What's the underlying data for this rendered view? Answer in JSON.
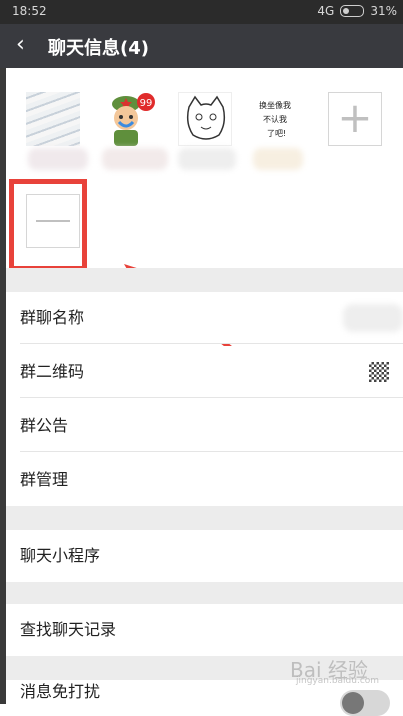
{
  "status_bar": {
    "time": "18:52",
    "network": "4G",
    "battery": "31%"
  },
  "header": {
    "back_icon": "chevron-left-icon",
    "title": "聊天信息(4)"
  },
  "members": {
    "avatars": [
      {
        "kind": "photo"
      },
      {
        "kind": "cartoon-soldier",
        "badge": "99"
      },
      {
        "kind": "cat-sketch"
      },
      {
        "kind": "handwriting",
        "text": "换坐像我 不认我 了吧!"
      }
    ],
    "add_icon": "plus-icon",
    "remove_icon": "minus-icon"
  },
  "settings": {
    "group_name": "群聊名称",
    "group_qr": "群二维码",
    "announcement": "群公告",
    "management": "群管理",
    "mini_programs": "聊天小程序",
    "search_history": "查找聊天记录",
    "mute": "消息免打扰"
  },
  "watermark": {
    "logo": "Bai 经验",
    "site": "jingyan.baidu.com"
  },
  "colors": {
    "header_bg": "#393a3f",
    "highlight": "#e8423a",
    "section_gap": "#ececec"
  }
}
